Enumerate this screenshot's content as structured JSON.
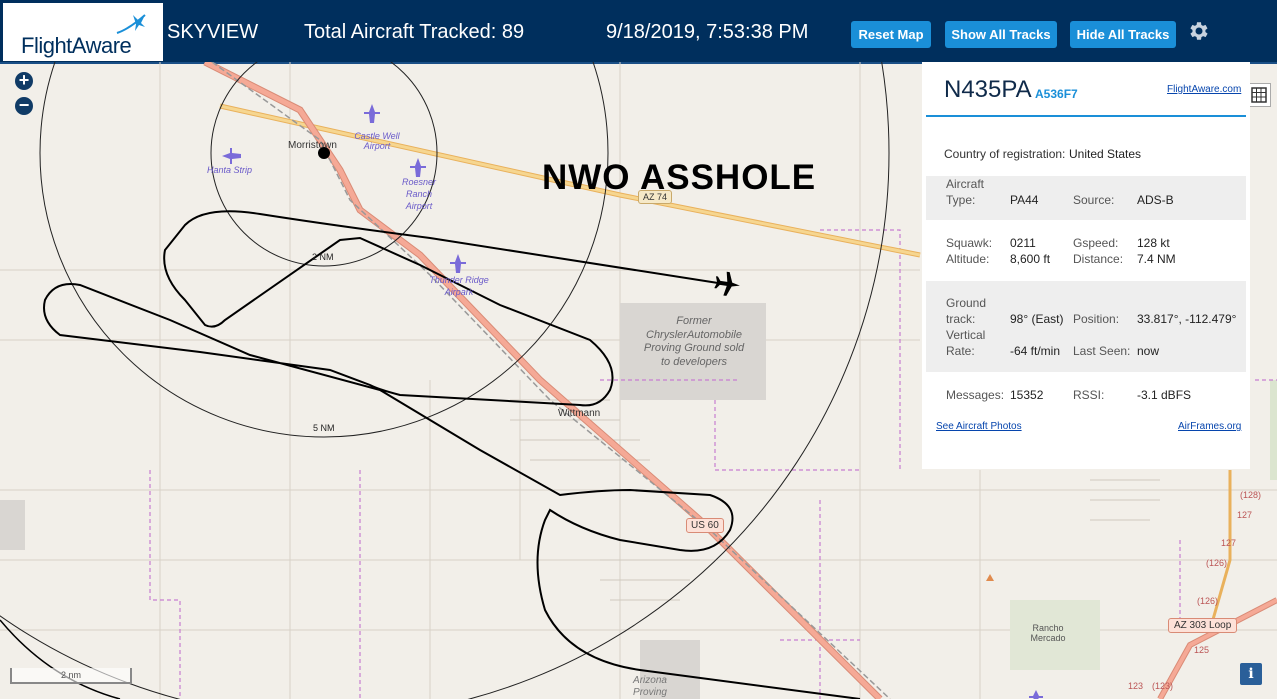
{
  "header": {
    "brand": "FlightAware",
    "app_name": "SKYVIEW",
    "total_tracked": "Total Aircraft Tracked: 89",
    "datetime": "9/18/2019, 7:53:38 PM",
    "reset_map_label": "Reset Map",
    "show_tracks_label": "Show All Tracks",
    "hide_tracks_label": "Hide All Tracks",
    "settings_icon": "gear-icon"
  },
  "map_controls": {
    "zoom_in": "+",
    "zoom_out": "−",
    "scale_label": "2 nm",
    "info_label": "i"
  },
  "map_labels": {
    "overlay_text": "NWO ASSHOLE",
    "ring_inner": "2 NM",
    "ring_outer": "5 NM",
    "morristown": "Morristown",
    "castle_well": "Castle Well Airport",
    "hanta_strip": "Hanta Strip",
    "roesner": "Roesner Ranch Airport",
    "thunder_ridge": "Thunder Ridge Airpark",
    "chrysler": "Former ChryslerAutomobile Proving Ground sold to developers",
    "wittmann": "Wittmann",
    "az74": "AZ 74",
    "us60": "US 60",
    "ranch_mercado": "Rancho Mercado",
    "az303": "AZ 303 Loop",
    "arizona_proving": "Arizona Proving",
    "r128": "(128)",
    "r127a": "127",
    "r127b": "127",
    "r126a": "(126)",
    "r126b": "(126)",
    "r125": "125",
    "r123a": "123",
    "r123b": "(123)"
  },
  "aircraft": {
    "registration": "N435PA",
    "hex": "A536F7",
    "flightaware_link": "FlightAware.com",
    "country_label": "Country of registration:",
    "country": "United States",
    "type_label_1": "Aircraft",
    "type_label_2": "Type:",
    "type": "PA44",
    "source_label": "Source:",
    "source": "ADS-B",
    "squawk_label": "Squawk:",
    "squawk": "0211",
    "gspeed_label": "Gspeed:",
    "gspeed": "128 kt",
    "altitude_label": "Altitude:",
    "altitude": "8,600 ft",
    "distance_label": "Distance:",
    "distance": "7.4 NM",
    "track_label_1": "Ground",
    "track_label_2": "track:",
    "track": "98° (East)",
    "position_label": "Position:",
    "position": "33.817°, -112.479°",
    "vrate_label_1": "Vertical",
    "vrate_label_2": "Rate:",
    "vrate": "-64 ft/min",
    "last_seen_label": "Last Seen:",
    "last_seen": "now",
    "messages_label": "Messages:",
    "messages": "15352",
    "rssi_label": "RSSI:",
    "rssi": "-3.1 dBFS",
    "photos_link": "See Aircraft Photos",
    "airframes_link": "AirFrames.org"
  },
  "colors": {
    "header_bg": "#002f5d",
    "button_bg": "#1a8fd8",
    "map_bg": "#f2efe9",
    "highway": "#f0a08a",
    "state_road": "#f6c26b",
    "boundary": "#c77ed1"
  }
}
